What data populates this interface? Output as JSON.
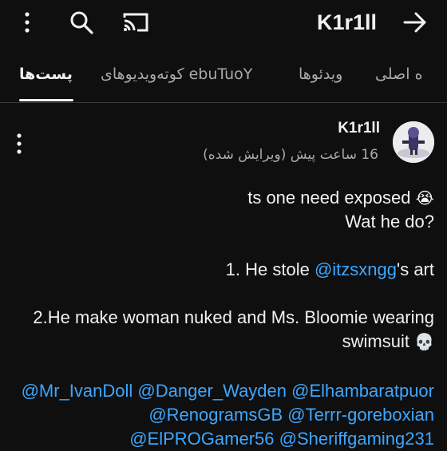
{
  "header": {
    "channel_name": "K1r1ll",
    "more_icon": "more-vert-icon",
    "search_icon": "search-icon",
    "cast_icon": "cast-icon",
    "back_icon": "arrow-right-icon"
  },
  "tabs": [
    {
      "label": "پست‌ها",
      "active": true
    },
    {
      "label": "YouTube کوته‌ویدیوهای",
      "active": false
    },
    {
      "label": "ویدئوها",
      "active": false
    },
    {
      "label": "ه اصلی",
      "active": false
    }
  ],
  "post": {
    "author": "K1r1ll",
    "meta": "16 ساعت پیش (ویرایش شده)",
    "line1": "ts one need exposed",
    "line1_emoji": "😭",
    "line2": "Wat he do?",
    "item1_prefix": "1. He stole ",
    "item1_mention": "@itzsxngg",
    "item1_suffix": "'s art",
    "item2_line1": "2.He make woman nuked and Ms. Bloomie wearing",
    "item2_line2": "swimsuit",
    "item2_emoji": "💀",
    "mentions_line1": "@Mr_IvanDoll @Danger_Wayden @Elhambaratpuor",
    "mentions_line2": "@RenogramsGB @Terrr-goreboxian",
    "mentions_line3": "@ElPROGamer56 @Sheriffgaming231"
  },
  "colors": {
    "background": "#0f0f0f",
    "text": "#f1f1f1",
    "secondary": "#aaaaaa",
    "link": "#3ea6ff"
  }
}
